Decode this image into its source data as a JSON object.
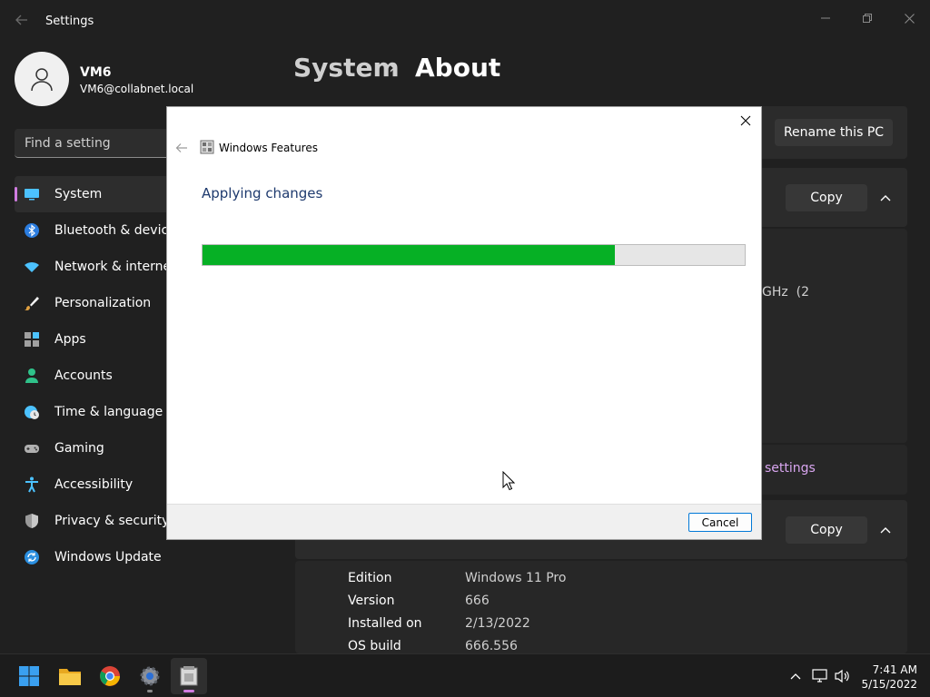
{
  "window": {
    "title": "Settings"
  },
  "user": {
    "name": "VM6",
    "email": "VM6@collabnet.local"
  },
  "search": {
    "placeholder": "Find a setting"
  },
  "sidebar": {
    "items": [
      {
        "label": "System",
        "icon": "monitor-icon",
        "active": true
      },
      {
        "label": "Bluetooth & devices",
        "icon": "bluetooth-icon"
      },
      {
        "label": "Network & internet",
        "icon": "wifi-icon"
      },
      {
        "label": "Personalization",
        "icon": "brush-icon"
      },
      {
        "label": "Apps",
        "icon": "apps-icon"
      },
      {
        "label": "Accounts",
        "icon": "person-icon"
      },
      {
        "label": "Time & language",
        "icon": "globe-clock-icon"
      },
      {
        "label": "Gaming",
        "icon": "gamepad-icon"
      },
      {
        "label": "Accessibility",
        "icon": "accessibility-icon"
      },
      {
        "label": "Privacy & security",
        "icon": "shield-icon"
      },
      {
        "label": "Windows Update",
        "icon": "update-icon"
      }
    ]
  },
  "breadcrumb": {
    "parent": "System",
    "separator": "›",
    "current": "About"
  },
  "main": {
    "rename_button": "Rename this PC",
    "device_specs": {
      "copy_button": "Copy",
      "partial_text": "GHz  (2"
    },
    "related_link_partial": "settings",
    "windows_specs": {
      "copy_button": "Copy",
      "rows": [
        {
          "label": "Edition",
          "value": "Windows 11 Pro"
        },
        {
          "label": "Version",
          "value": "666"
        },
        {
          "label": "Installed on",
          "value": "2/13/2022"
        },
        {
          "label": "OS build",
          "value": "666.556"
        }
      ]
    }
  },
  "dialog": {
    "app_title": "Windows Features",
    "heading": "Applying changes",
    "progress": 0.76,
    "cancel_button": "Cancel"
  },
  "taskbar": {
    "apps": [
      "start-icon",
      "file-explorer-icon",
      "chrome-icon",
      "settings-icon",
      "windows-features-icon"
    ],
    "clock": {
      "time": "7:41 AM",
      "date": "5/15/2022"
    }
  },
  "colors": {
    "accent": "#d07ce0",
    "progress_fill": "#06b025",
    "dialog_heading": "#1e3a6e"
  }
}
